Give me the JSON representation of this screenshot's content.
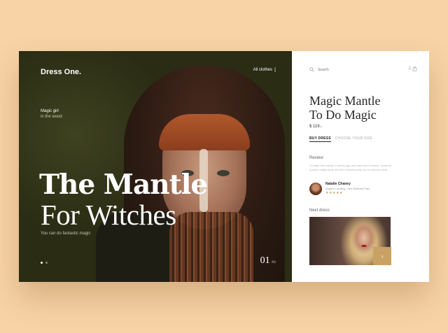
{
  "brand": "Dress One.",
  "menu": {
    "label": "All clothes"
  },
  "hero": {
    "tagline_title": "Magic girl",
    "tagline_sub": "in the wood",
    "title_line1": "The Mantle",
    "title_line2": "For Witches",
    "caption": "You can do fantastic magic",
    "slide_current": "01",
    "slide_total": "/02",
    "slide_count": 2,
    "active_slide": 1
  },
  "search": {
    "placeholder": "Search"
  },
  "cart": {
    "count": "0"
  },
  "product": {
    "title_line1": "Magic Mantle",
    "title_line2": "To Do Magic",
    "price": "$ 119.-",
    "buy_label": "BUY DRESS",
    "size_label": "CHOOSE YOUR SIZE"
  },
  "review": {
    "heading": "Review",
    "text": "I bought this mantle 2 weeks ago and have worn it twice. Great for a party, magic party and fire following wear for a costume party.",
    "author_name": "Natalie Chaney",
    "author_location": "Angel's Landing, Zion National Park",
    "stars": "★★★★★",
    "rating": 5
  },
  "next_dress": {
    "heading": "Next dress",
    "button": "›"
  },
  "colors": {
    "background": "#f7d3a6",
    "accent": "#c9a164",
    "hero_dark": "#262712"
  },
  "icons": [
    "menu-dots-icon",
    "search-icon",
    "cart-icon",
    "star-icon",
    "arrow-right-icon"
  ]
}
